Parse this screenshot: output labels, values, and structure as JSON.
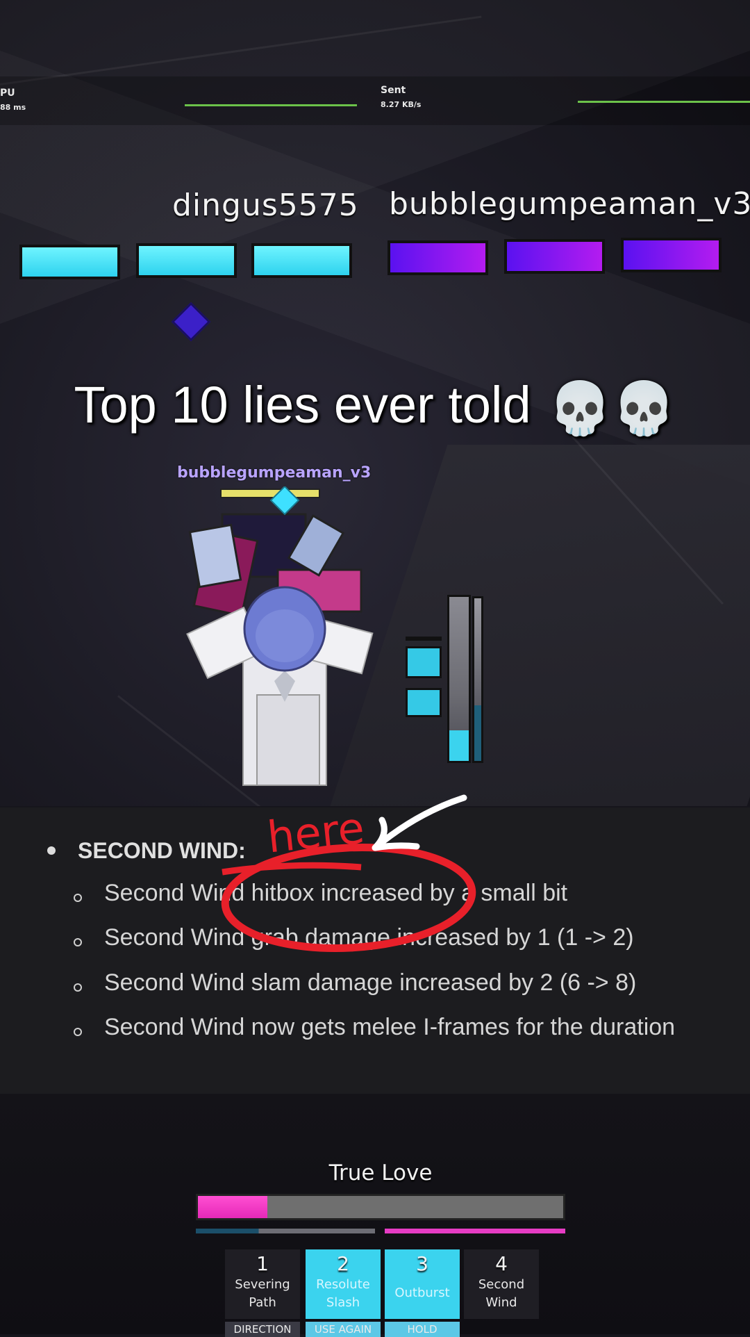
{
  "stats": {
    "left_label": "PU",
    "left_value": "88 ms",
    "right_label": "Sent",
    "right_value": "8.27 KB/s"
  },
  "players": [
    {
      "name": "dingus5575",
      "bar_color": "#3fe0f5",
      "bars": 3
    },
    {
      "name": "bubblegumpeaman_v3",
      "bar_color": "#8c18f0",
      "bars": 3
    }
  ],
  "caption": {
    "text": "Top 10 lies ever told",
    "emoji": "💀💀"
  },
  "character": {
    "overhead_name": "bubblegumpeaman_v3"
  },
  "annotation": {
    "text": "here",
    "color": "#e8202a"
  },
  "patch_notes": {
    "heading": "SECOND WIND:",
    "items": [
      "Second Wind hitbox increased by a small bit",
      "Second Wind grab damage increased by 1 (1 -> 2)",
      "Second Wind slam damage increased by 2 (6 -> 8)",
      "Second Wind now gets melee I-frames for the duration"
    ]
  },
  "hud": {
    "title": "True Love",
    "main_bar_fill": 0.19,
    "main_bar_color": "#f23fc8",
    "abilities": [
      {
        "key": "1",
        "name_line1": "Severing",
        "name_line2": "Path",
        "tag": "DIRECTION",
        "active": false
      },
      {
        "key": "2",
        "name_line1": "Resolute",
        "name_line2": "Slash",
        "tag": "USE AGAIN",
        "active": true
      },
      {
        "key": "3",
        "name_line1": "Outburst",
        "name_line2": "",
        "tag": "HOLD",
        "active": true
      },
      {
        "key": "4",
        "name_line1": "Second",
        "name_line2": "Wind",
        "tag": "",
        "active": false
      }
    ]
  }
}
